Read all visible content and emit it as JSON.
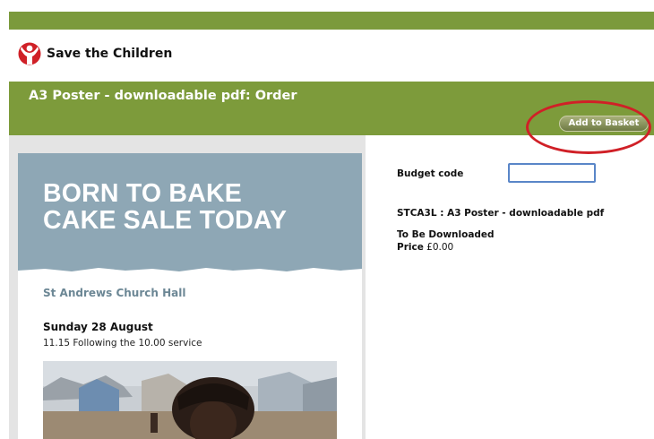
{
  "brand": {
    "name": "Save the Children",
    "color": "#d02027"
  },
  "banner": {
    "title": "A3 Poster - downloadable pdf: Order",
    "add_to_basket": "Add to Basket"
  },
  "poster": {
    "headline_line1": "BORN TO BAKE",
    "headline_line2": "CAKE SALE TODAY",
    "venue": "St Andrews Church Hall",
    "date": "Sunday 28 August",
    "time": "11.15 Following the 10.00 service"
  },
  "order": {
    "budget_label": "Budget code",
    "budget_value": "",
    "product": "STCA3L : A3 Poster - downloadable pdf",
    "delivery": "To Be Downloaded",
    "price_label": "Price",
    "price_value": "£0.00"
  },
  "colors": {
    "header_green": "#7d9b3b",
    "poster_blue": "#8ea7b5",
    "highlight_red": "#d02027"
  }
}
